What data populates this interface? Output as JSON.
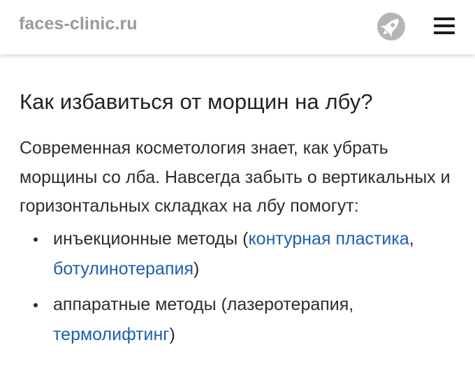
{
  "header": {
    "site_name": "faces-clinic.ru",
    "rocket_icon": "rocket-icon",
    "menu_icon": "hamburger-menu-icon"
  },
  "article": {
    "title": "Как избавиться от морщин на лбу?",
    "intro": "Современная косметология знает, как убрать морщины со лба. Навсегда забыть о вертикальных и горизонтальных складках на лбу помогут:",
    "items": [
      {
        "prefix": "инъекционные методы (",
        "link1": "контурная пластика",
        "separator": ", ",
        "link2": "ботулинотерапия",
        "suffix": ")"
      },
      {
        "prefix": "аппаратные методы (лазеротерапия, ",
        "link1": "термолифтинг",
        "suffix": ")"
      }
    ]
  },
  "colors": {
    "link": "#1c5fae",
    "text": "#2d2d2d",
    "site_name": "#9a9a9a"
  }
}
